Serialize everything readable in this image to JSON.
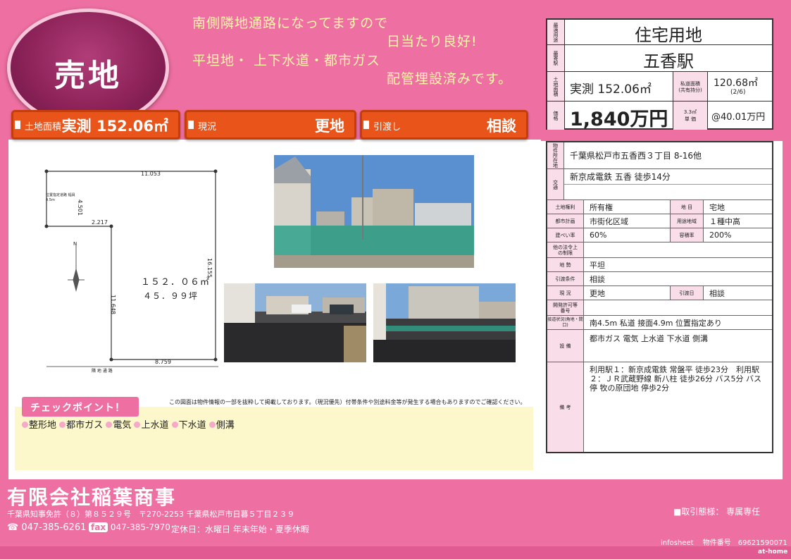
{
  "badge": "売地",
  "headline": {
    "line1": "南側隣地通路になってますので",
    "line2": "日当たり良好!",
    "line3": "平坦地・ 上下水道・都市ガス",
    "line4": "配管埋設済みです。"
  },
  "summary_bars": [
    {
      "label": "土地面積",
      "value": "実測 152.06㎡"
    },
    {
      "label": "現況",
      "value": "更地"
    },
    {
      "label": "引渡し",
      "value": "相談"
    }
  ],
  "infobox": {
    "type_label": "最適用途",
    "type_value": "住宅用地",
    "station_label": "最寄駅",
    "station_value": "五香駅",
    "area_label": "土地面積",
    "area_value": "実測 152.06㎡",
    "private_road_label_1": "私道面積",
    "private_road_label_2": "(共有持分)",
    "private_road_value": "120.68㎡",
    "private_road_share": "(2/6)",
    "price_label": "価格",
    "price_value": "1,840万円",
    "unit_label_1": "3.3㎡",
    "unit_label_2": "単 価",
    "unit_value": "@40.01万円"
  },
  "details": {
    "address_label": "物件所在地",
    "address": "千葉県松戸市五香西３丁目 8-16他",
    "traffic_label": "交通",
    "traffic": "新京成電鉄 五香 徒歩14分",
    "rights_label": "土地権利",
    "rights": "所有権",
    "chimoku_label": "地 目",
    "chimoku": "宅地",
    "city_plan_label": "都市計画",
    "city_plan": "市街化区域",
    "zoning_label": "用途地域",
    "zoning": "１種中高",
    "coverage_label": "建ぺい率",
    "coverage": "60%",
    "far_label": "容積率",
    "far": "200%",
    "other_law_label": "他の法令上の制限",
    "terrain_label": "地 勢",
    "terrain": "平坦",
    "conditions_label": "引渡条件",
    "conditions": "相談",
    "current_label": "現 況",
    "current": "更地",
    "handover_label": "引渡日",
    "handover": "相談",
    "dev_permit_label": "開発許可等番号",
    "road_label": "接道状況(角地・間口)",
    "road": "南4.5m 私道 接面4.9m 位置指定あり",
    "facilities_label": "設 備",
    "facilities": "都市ガス 電気 上水道 下水道 側溝",
    "remarks_label": "備 考",
    "remarks": "利用駅１：新京成電鉄 常盤平 徒歩23分　利用駅２：ＪＲ武蔵野線 新八柱 徒歩26分 バス5分 バス停 牧の原団地 停歩2分"
  },
  "survey": {
    "top": "11.053",
    "side_top": "4.501",
    "mid": "2.217",
    "right": "16.155",
    "left": "11.648",
    "bottom": "8.759",
    "area_sqm": "１５２．０６㎡",
    "area_tsubo": "４５．９９坪",
    "road_label": "隣 地 通 路",
    "small_note": "位置指定道路 幅員4.5m",
    "north": "N"
  },
  "notice": "この図面は物件情報の一部を抜粋して掲載しております。（現況優先）付帯条件や別途料金等が発生する場合もありますのでご確認ください。",
  "checkpoint": {
    "title": "チェックポイント！",
    "items": [
      "整形地",
      "都市ガス",
      "電気",
      "上水道",
      "下水道",
      "側溝"
    ]
  },
  "company": {
    "name": "有限会社稲葉商事",
    "license": "千葉県知事免許（８）第８５２９号　〒270-2253  千葉県松戸市日暮５丁目２３９",
    "tel": "047-385-6261",
    "fax_tag": "fax",
    "fax": "047-385-7970",
    "holiday": "定休日：水曜日 年末年始・夏季休暇",
    "deal": "■取引態様：  専属専任",
    "infosheet": "infosheet　 物件番号　69621590071",
    "brand": "at-home"
  },
  "colors": {
    "pink": "#ee6fa2",
    "orange": "#e8541a",
    "badge": "#8d2359",
    "yellow": "#fff8a8"
  }
}
